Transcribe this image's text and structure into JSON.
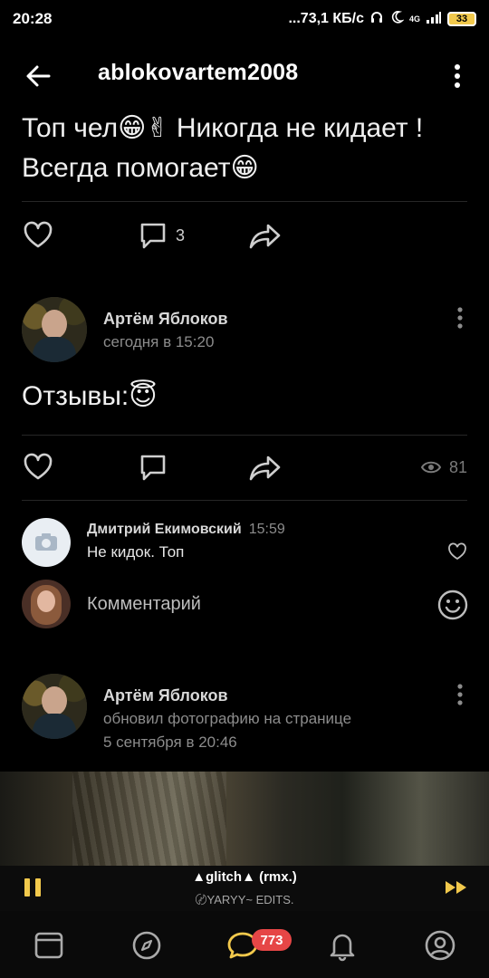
{
  "status_bar": {
    "time": "20:28",
    "net_speed": "...73,1 КБ/с",
    "network": "4G",
    "battery": "33"
  },
  "header": {
    "title": "ablokovartem2008"
  },
  "post1": {
    "text": "Топ чел😁✌ Никогда не кидает ! Всегда помогает😁",
    "comment_count": "3"
  },
  "post2": {
    "author": "Артём Яблоков",
    "time": "сегодня в 15:20",
    "text": "Отзывы:😇",
    "views": "81",
    "comment": {
      "author": "Дмитрий Екимовский",
      "time": "15:59",
      "text": "Не кидок. Топ"
    },
    "compose_placeholder": "Комментарий"
  },
  "post3": {
    "author": "Артём Яблоков",
    "action": "обновил фотографию на странице",
    "time": "5 сентября в 20:46"
  },
  "player": {
    "track": "▲glitch▲ (rmx.)",
    "artist": "〄YARYY~ EDITS."
  },
  "nav": {
    "messages_badge": "773"
  },
  "colors": {
    "accent": "#f2c94c",
    "badge": "#e64646",
    "background": "#000000"
  }
}
